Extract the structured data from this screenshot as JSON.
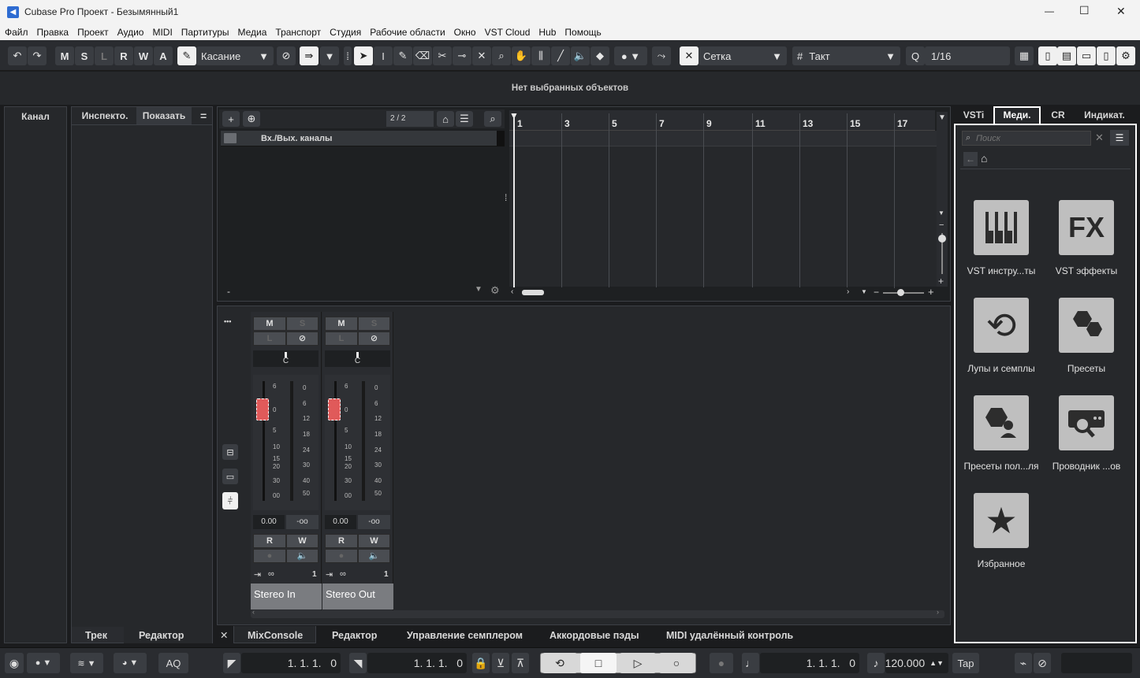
{
  "window": {
    "title": "Cubase Pro Проект - Безымянный1",
    "min": "—",
    "max": "☐",
    "close": "✕"
  },
  "menu": [
    "Файл",
    "Правка",
    "Проект",
    "Аудио",
    "MIDI",
    "Партитуры",
    "Медиа",
    "Транспорт",
    "Студия",
    "Рабочие области",
    "Окно",
    "VST Cloud",
    "Hub",
    "Помощь"
  ],
  "toolbar": {
    "undo": "↶",
    "redo": "↷",
    "m": "M",
    "s": "S",
    "l": "L",
    "r": "R",
    "w": "W",
    "a": "A",
    "mode": "Касание",
    "grid_type": "Сетка",
    "grid_value": "Такт",
    "quantize": "1/16"
  },
  "infoline": "Нет выбранных объектов",
  "left": {
    "channel_tab": "Канал",
    "inspector_tab": "Инспекто.",
    "show_tab": "Показать",
    "menu_icon": "="
  },
  "tracklist": {
    "count": "2 / 2",
    "folder_name": "Вх./Вых. каналы",
    "dash": "-"
  },
  "ruler": [
    "1",
    "3",
    "5",
    "7",
    "9",
    "11",
    "13",
    "15",
    "17"
  ],
  "mixer": {
    "more": "•••",
    "channels": [
      {
        "m": "M",
        "s": "S",
        "l": "L",
        "pan": "C",
        "vol": "0.00",
        "peak": "-oo",
        "r": "R",
        "w": "W",
        "num": "1",
        "name": "Stereo In"
      },
      {
        "m": "M",
        "s": "S",
        "l": "L",
        "pan": "C",
        "vol": "0.00",
        "peak": "-oo",
        "r": "R",
        "w": "W",
        "num": "1",
        "name": "Stereo Out"
      }
    ],
    "scale_left": [
      "6",
      "0",
      "5",
      "10",
      "15",
      "20",
      "30",
      "00"
    ],
    "scale_right": [
      "0",
      "6",
      "12",
      "18",
      "24",
      "30",
      "40",
      "50"
    ]
  },
  "right": {
    "tabs": [
      "VSTi",
      "Меди.",
      "CR",
      "Индикат."
    ],
    "search_placeholder": "Поиск",
    "items": [
      {
        "label": "VST инстру...ты",
        "icon": "piano-icon"
      },
      {
        "label": "VST эффекты",
        "icon": "fx-icon",
        "glyph": "FX"
      },
      {
        "label": "Лупы и семплы",
        "icon": "loop-icon"
      },
      {
        "label": "Пресеты",
        "icon": "presets-icon"
      },
      {
        "label": "Пресеты пол...ля",
        "icon": "user-presets-icon"
      },
      {
        "label": "Проводник ...ов",
        "icon": "browser-icon"
      },
      {
        "label": "Избранное",
        "icon": "star-icon"
      }
    ]
  },
  "bottom_tabs": {
    "left": [
      "Трек",
      "Редактор"
    ],
    "close": "✕",
    "center": [
      "MixConsole",
      "Редактор",
      "Управление семплером",
      "Аккордовые пэды",
      "MIDI удалённый контроль"
    ]
  },
  "transport": {
    "aq": "AQ",
    "left_locator": "1. 1. 1.   0",
    "right_locator": "1. 1. 1.   0",
    "position": "1. 1. 1.   0",
    "tempo": "120.000",
    "tap": "Tap"
  }
}
